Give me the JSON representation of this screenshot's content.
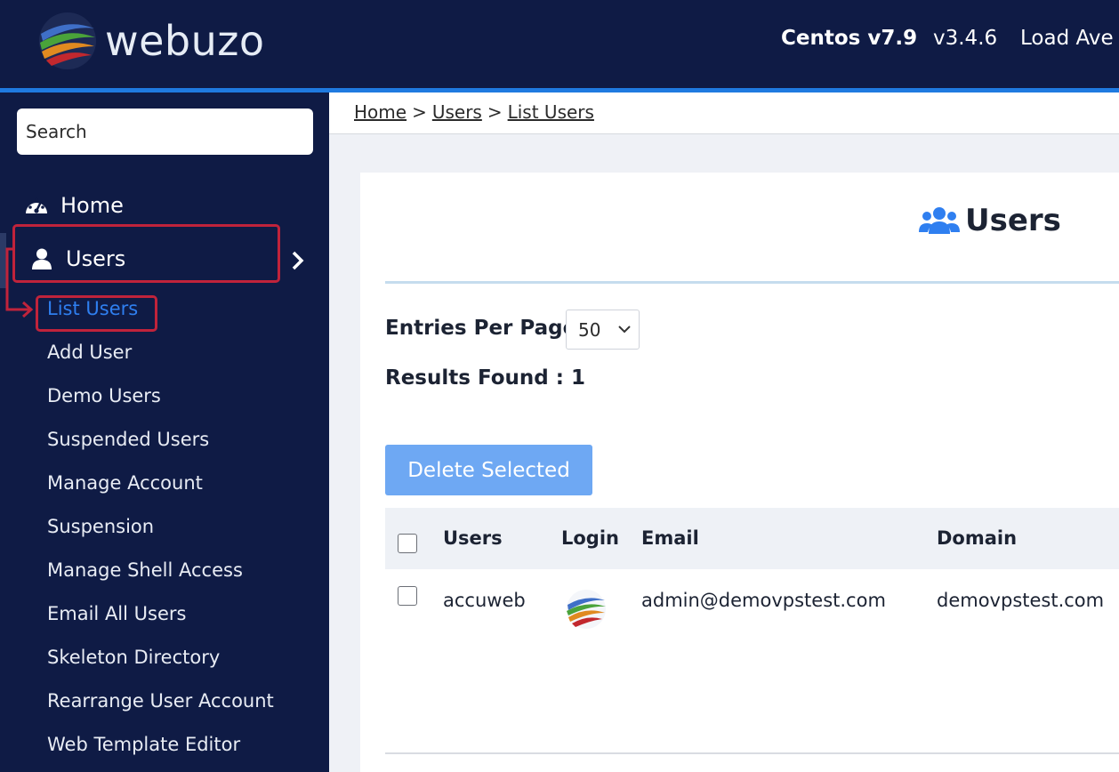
{
  "header": {
    "brand": "webuzo",
    "os": "Centos v7.9",
    "version": "v3.4.6",
    "load_label": "Load Ave"
  },
  "sidebar": {
    "search_placeholder": "Search",
    "home_label": "Home",
    "users_label": "Users",
    "sub_items": [
      "List Users",
      "Add User",
      "Demo Users",
      "Suspended Users",
      "Manage Account",
      "Suspension",
      "Manage Shell Access",
      "Email All Users",
      "Skeleton Directory",
      "Rearrange User Account",
      "Web Template Editor"
    ],
    "active_item": "List Users"
  },
  "breadcrumb": [
    "Home",
    "Users",
    "List Users"
  ],
  "page": {
    "title": "Users",
    "entries_label": "Entries Per Page",
    "entries_value": "50",
    "results_label": "Results Found : 1",
    "delete_button": "Delete Selected"
  },
  "table": {
    "columns": [
      "Users",
      "Login",
      "Email",
      "Domain"
    ],
    "rows": [
      {
        "user": "accuweb",
        "email": "admin@demovpstest.com",
        "domain": "demovpstest.com"
      }
    ]
  },
  "colors": {
    "navy": "#0f1b45",
    "accent_blue": "#1f7ae0",
    "active_link": "#2f7ff0",
    "highlight_red": "#c0233b",
    "button_blue": "#6ea8f3"
  }
}
